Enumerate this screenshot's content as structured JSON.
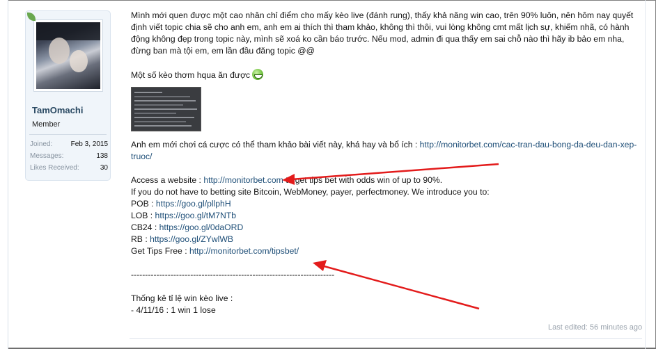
{
  "user": {
    "name": "TamOmachi",
    "title": "Member",
    "stats": [
      {
        "label": "Joined:",
        "value": "Feb 3, 2015"
      },
      {
        "label": "Messages:",
        "value": "138"
      },
      {
        "label": "Likes Received:",
        "value": "30"
      }
    ]
  },
  "post": {
    "intro": "Mình mới quen được một cao nhân chỉ điểm cho mấy kèo live (đánh rung), thấy khả năng win cao, trên 90% luôn, nên hôm nay quyết định viết topic chia sẽ cho anh em, anh em ai thích thì tham khảo, không thì thôi, vui lòng không cmt mất lịch sự, khiếm nhã, có hành động không đẹp trong topic này, mình sẽ xoá ko cần báo trước. Nếu mod, admin đi qua thấy em sai chỗ nào thì hãy ib bảo em nha, đừng ban mà tội em, em lần đầu đăng topic @@",
    "some_bets": "Một số kèo thơm hqua ăn được",
    "newbie_text": "Anh em mới chơi cá cược có thể tham khảo bài viết này, khá hay và bổ ích : ",
    "newbie_link": "http://monitorbet.com/cac-tran-dau-bong-da-deu-dan-xep-truoc/",
    "access_prefix": "Access a website : ",
    "access_link": "http://monitorbet.com",
    "access_suffix": " to get tips bet with odds win of up to 90%.",
    "betting_line": "If you do not have to betting site Bitcoin, WebMoney, payer, perfectmoney. We introduce you to:",
    "sites": [
      {
        "label": "POB : ",
        "link": "https://goo.gl/pllphH"
      },
      {
        "label": "LOB : ",
        "link": "https://goo.gl/tM7NTb"
      },
      {
        "label": "CB24 : ",
        "link": "https://goo.gl/0daORD"
      },
      {
        "label": "RB : ",
        "link": "https://goo.gl/ZYwlWB"
      }
    ],
    "tips_label": "Get Tips Free : ",
    "tips_link": "http://monitorbet.com/tipsbet/",
    "separator": "------------------------------------------------------------------------",
    "stats_heading": "Thống kê tỉ lệ win kèo live :",
    "stats_line": "- 4/11/16 : 1 win 1 lose",
    "last_edited": "Last edited: 56 minutes ago"
  },
  "colors": {
    "link": "#1f4f78",
    "arrow": "#e31b1b",
    "card_bg": "#f0f5fa"
  }
}
